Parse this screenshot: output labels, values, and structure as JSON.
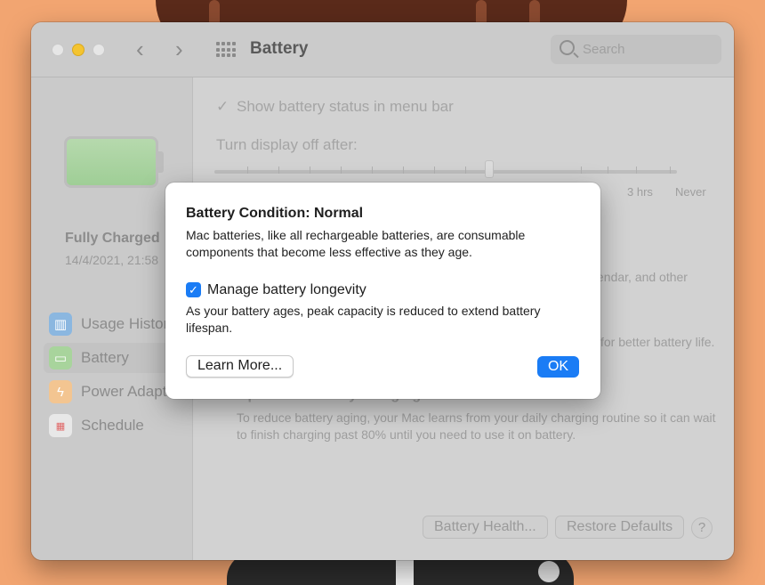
{
  "window": {
    "title": "Battery",
    "search_placeholder": "Search"
  },
  "sidebar": {
    "charge_status": "Fully Charged",
    "charge_date": "14/4/2021, 21:58",
    "items": [
      {
        "label": "Usage History",
        "icon": "bar-chart-icon",
        "color": "#6fa8dc"
      },
      {
        "label": "Battery",
        "icon": "battery-icon",
        "color": "#93c47d"
      },
      {
        "label": "Power Adapter",
        "icon": "lightning-icon",
        "color": "#f6b26b"
      },
      {
        "label": "Schedule",
        "icon": "calendar-icon",
        "color": "#e06666"
      }
    ]
  },
  "main": {
    "show_status_label": "Show battery status in menu bar",
    "show_status_checked": true,
    "display_off_label": "Turn display off after:",
    "slider_labels": [
      "3 hrs",
      "Never"
    ],
    "partial_text_1": "endar, and other",
    "partial_text_2": "for better battery life.",
    "optimized_title": "Optimized battery charging",
    "optimized_desc": "To reduce battery aging, your Mac learns from your daily charging routine so it can wait to finish charging past 80% until you need to use it on battery.",
    "battery_health_button": "Battery Health...",
    "restore_defaults_button": "Restore Defaults",
    "help_button": "?"
  },
  "dialog": {
    "heading": "Battery Condition: Normal",
    "description": "Mac batteries, like all rechargeable batteries, are consumable components that become less effective as they age.",
    "checkbox_label": "Manage battery longevity",
    "checkbox_checked": true,
    "checkbox_description": "As your battery ages, peak capacity is reduced to extend battery lifespan.",
    "learn_more_button": "Learn More...",
    "ok_button": "OK"
  }
}
